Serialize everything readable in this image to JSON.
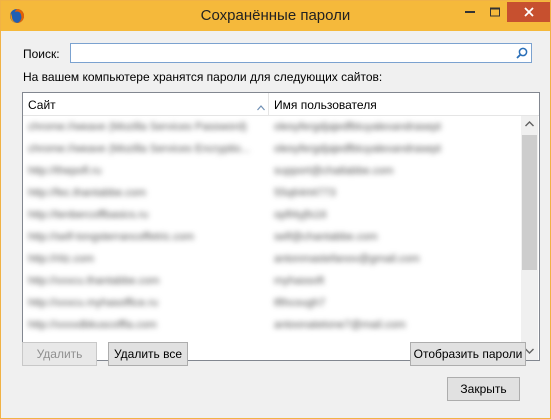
{
  "window": {
    "title": "Сохранённые пароли",
    "icon": "firefox-icon"
  },
  "search": {
    "label": "Поиск:",
    "value": "",
    "placeholder": "",
    "icon": "search-icon"
  },
  "info_text": "На вашем компьютере хранятся пароли для следующих сайтов:",
  "table": {
    "columns": [
      "Сайт",
      "Имя пользователя"
    ],
    "sort_icon": "sort-ascending-icon",
    "rows": [
      {
        "site": "chrome://weave (Mozilla Services Password)",
        "user": "olesyfergdjajedfbtuyalexandrasept"
      },
      {
        "site": "chrome://weave (Mozilla Services Encryptio...",
        "user": "olesyfergdjajedfbtuyalexandrasept"
      },
      {
        "site": "http://thepofl.ru",
        "user": "support@chatlabbe.com"
      },
      {
        "site": "http://fec.thantabbe.com",
        "user": "55q64rt4773"
      },
      {
        "site": "http://tenbercoffbasics.ru",
        "user": "opfl4yjfs16"
      },
      {
        "site": "http://self-tongsterrancoffetric.com",
        "user": "self@chantabbe.com"
      },
      {
        "site": "http://ritz.com",
        "user": "antonmastefanov@gmail.com"
      },
      {
        "site": "http://xxxcu.thantabbe.com",
        "user": "myhassoft"
      },
      {
        "site": "http://xxxcu.myhasoffice.ru",
        "user": "tfthcough7"
      },
      {
        "site": "http://xxxxdbkuscoffla.com",
        "user": "antoonatetone7@mail.com"
      }
    ]
  },
  "buttons": {
    "remove": "Удалить",
    "remove_all": "Удалить все",
    "show_passwords": "Отобразить пароли",
    "close": "Закрыть"
  },
  "colors": {
    "titlebar": "#f5b93b",
    "close_button": "#c7502f",
    "window_bg": "#f0f0f0"
  }
}
